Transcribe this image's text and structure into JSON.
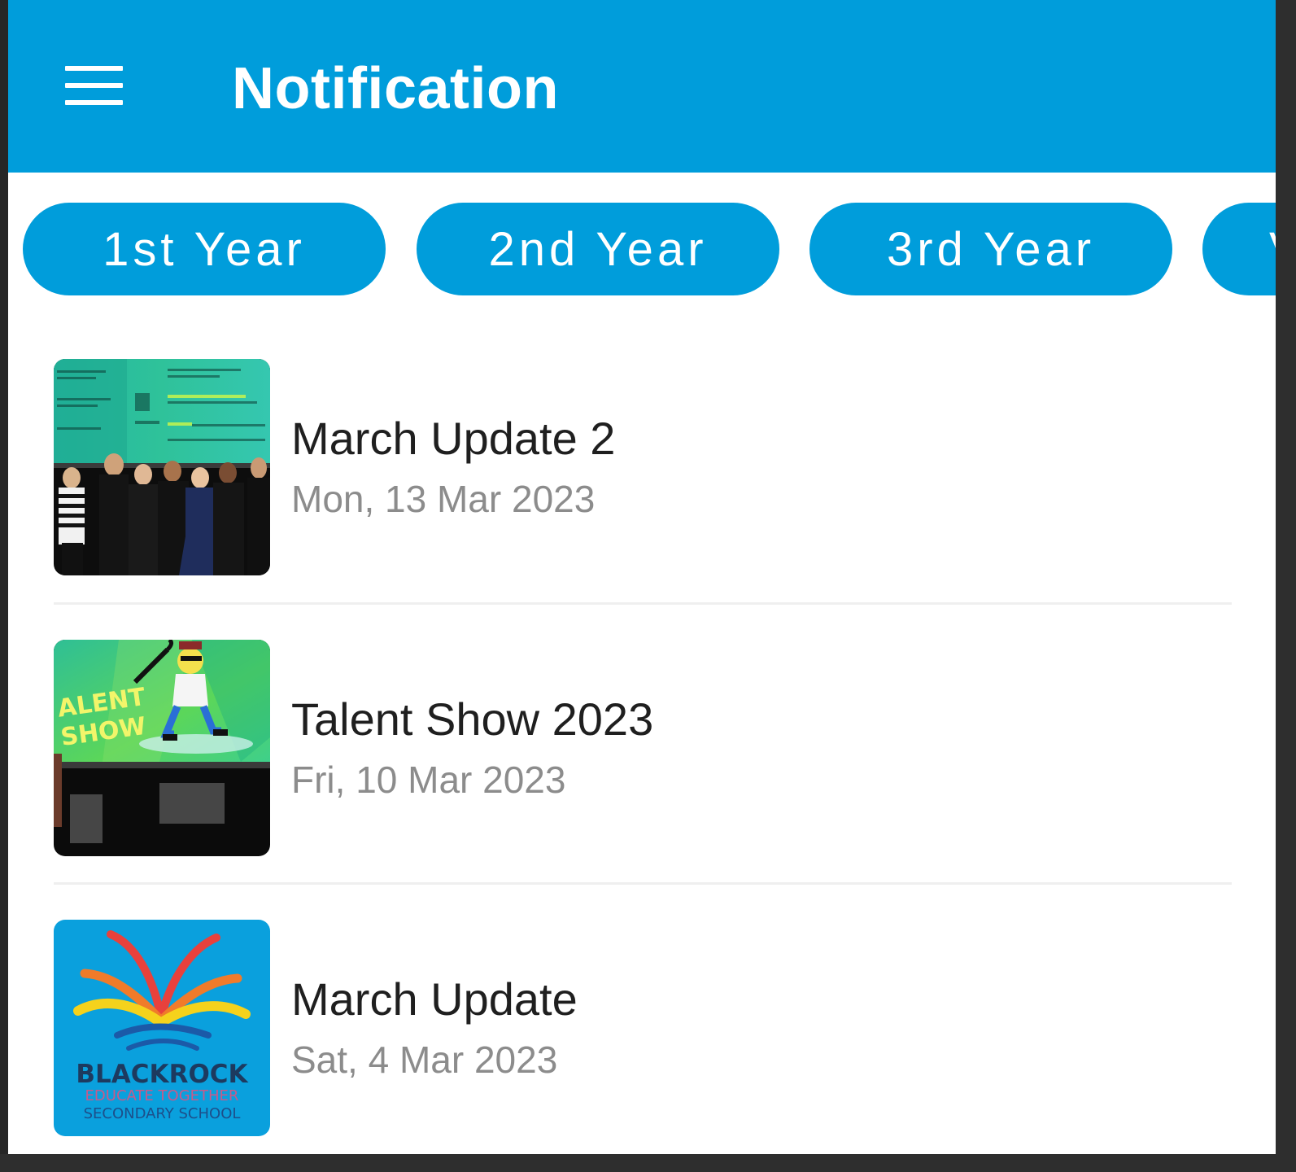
{
  "appbar": {
    "menu_icon": "hamburger-menu-icon",
    "title": "Notification"
  },
  "tabs": [
    {
      "label": "1st Year"
    },
    {
      "label": "2nd Year"
    },
    {
      "label": "3rd Year"
    },
    {
      "label": "V"
    }
  ],
  "notifications": [
    {
      "title": "March Update 2",
      "date": "Mon, 13 Mar 2023",
      "thumbnail": "students-on-stage-photo"
    },
    {
      "title": "Talent Show 2023",
      "date": "Fri, 10 Mar 2023",
      "thumbnail": "talent-show-stage-photo"
    },
    {
      "title": "March Update",
      "date": "Sat, 4 Mar 2023",
      "thumbnail": "school-logo"
    }
  ],
  "photo_text": {
    "talent_show_line1": "ALENT",
    "talent_show_line2": "SHOW"
  },
  "logo": {
    "name": "BLACKROCK",
    "line2": "EDUCATE TOGETHER",
    "line3": "SECONDARY SCHOOL"
  },
  "colors": {
    "primary": "#009ddb",
    "title_text": "#1f1f1f",
    "date_text": "#8c8c8c"
  }
}
